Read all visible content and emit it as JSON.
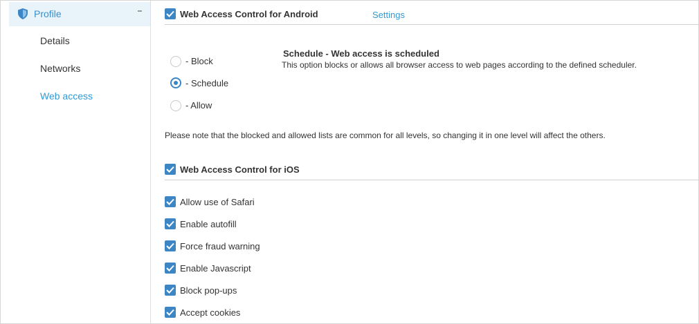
{
  "sidebar": {
    "profile_label": "Profile",
    "items": [
      {
        "label": "Details"
      },
      {
        "label": "Networks"
      },
      {
        "label": "Web access"
      }
    ]
  },
  "android": {
    "title": "Web Access Control for Android",
    "settings_link": "Settings",
    "options": [
      "- Block",
      "- Schedule",
      "- Allow"
    ],
    "selected": "- Schedule",
    "desc_title": "Schedule - Web access is scheduled",
    "desc_text": "This option blocks or allows all browser access to web pages according to the defined scheduler."
  },
  "note": "Please note that the blocked and allowed lists are common for all levels, so changing it in one level will affect the others.",
  "ios": {
    "title": "Web Access Control for iOS",
    "options": [
      "Allow use of Safari",
      "Enable autofill",
      "Force fraud warning",
      "Enable Javascript",
      "Block pop-ups",
      "Accept cookies"
    ]
  },
  "colors": {
    "accent": "#3d86c6",
    "link": "#2e9ad7",
    "selected_bg": "#e9f3fa"
  }
}
